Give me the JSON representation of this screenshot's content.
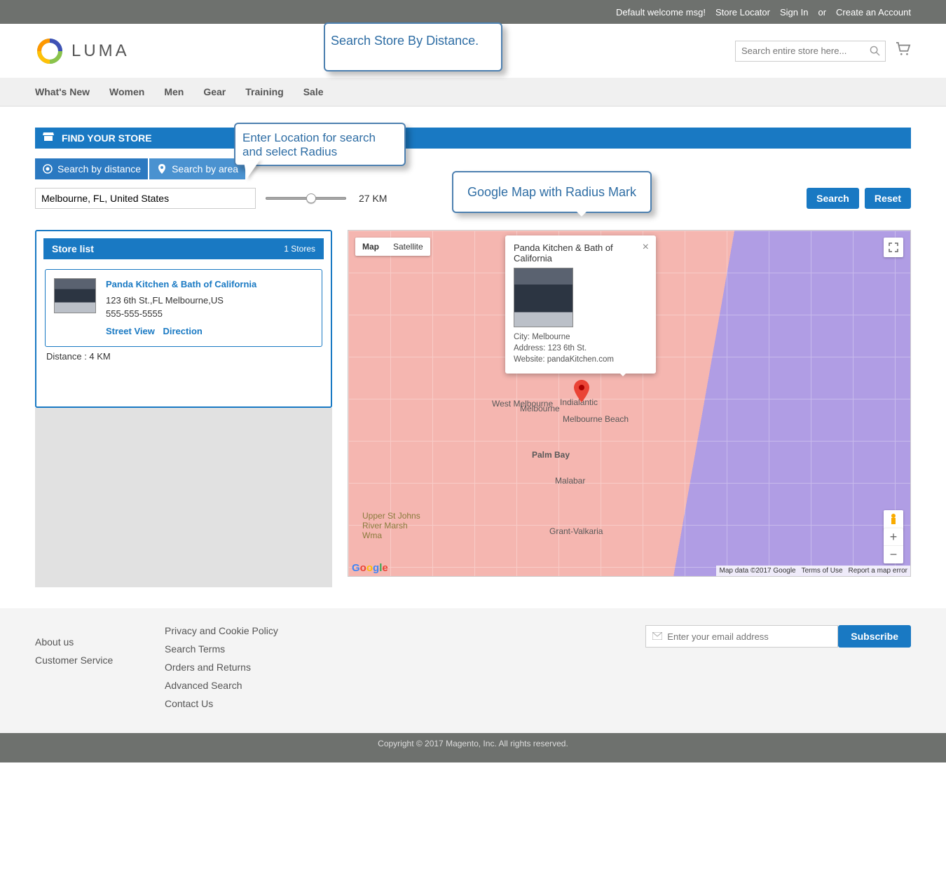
{
  "topbar": {
    "welcome": "Default welcome msg!",
    "store_locator": "Store Locator",
    "sign_in": "Sign In",
    "or": "or",
    "create_account": "Create an Account"
  },
  "header": {
    "logo_text": "LUMA",
    "search_placeholder": "Search entire store here..."
  },
  "nav": [
    "What's New",
    "Women",
    "Men",
    "Gear",
    "Training",
    "Sale"
  ],
  "callouts": {
    "c1": "Search Store By Distance.",
    "c2": "Enter Location for search and select Radius",
    "c3": "Google Map with Radius Mark"
  },
  "find": {
    "title": "FIND YOUR STORE",
    "tab_distance": "Search by distance",
    "tab_area": "Search by area",
    "location_value": "Melbourne, FL, United States",
    "distance_label": "27 KM",
    "search_btn": "Search",
    "reset_btn": "Reset"
  },
  "storelist": {
    "title": "Store list",
    "count": "1 Stores",
    "item": {
      "name": "Panda Kitchen & Bath of California",
      "address": "123 6th St.,FL Melbourne,US",
      "phone": "555-555-5555",
      "street_view": "Street View",
      "direction": "Direction",
      "distance": "Distance : 4 KM"
    }
  },
  "map": {
    "type_map": "Map",
    "type_sat": "Satellite",
    "info": {
      "title": "Panda Kitchen & Bath of California",
      "city": "City: Melbourne",
      "address": "Address: 123 6th St.",
      "website": "Website: pandaKitchen.com"
    },
    "cities": {
      "wm": "West Melbourne",
      "mel": "Melbourne",
      "mb": "Melbourne Beach",
      "ind": "Indialantic",
      "pb": "Palm Bay",
      "mal": "Malabar",
      "gv": "Grant-Valkaria",
      "usj": "Upper St Johns River Marsh Wma"
    },
    "footer": {
      "data": "Map data ©2017 Google",
      "terms": "Terms of Use",
      "report": "Report a map error"
    }
  },
  "footer": {
    "col1": [
      "About us",
      "Customer Service"
    ],
    "col2": [
      "Privacy and Cookie Policy",
      "Search Terms",
      "Orders and Returns",
      "Advanced Search",
      "Contact Us"
    ],
    "subscribe_placeholder": "Enter your email address",
    "subscribe_btn": "Subscribe"
  },
  "copyright": "Copyright © 2017 Magento, Inc. All rights reserved."
}
